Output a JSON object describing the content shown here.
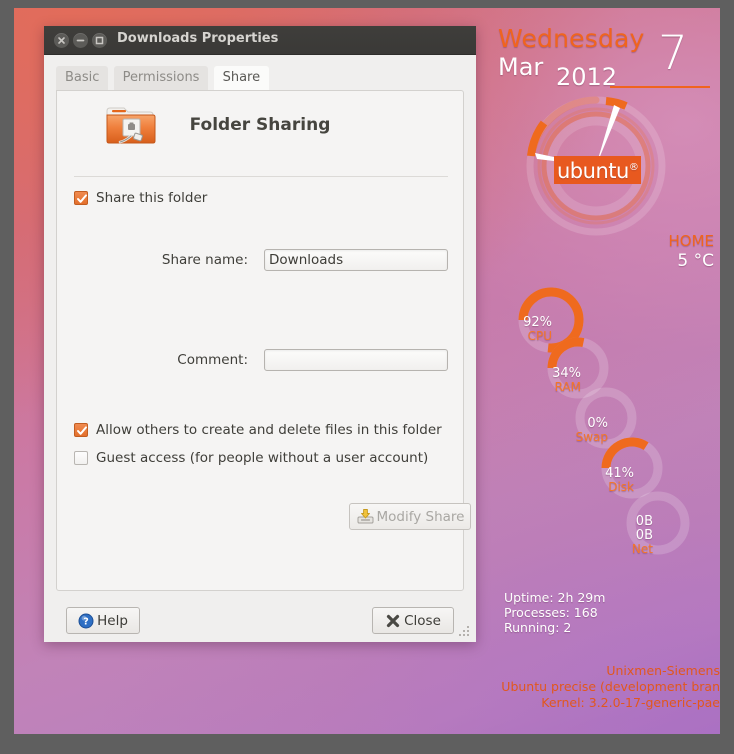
{
  "window": {
    "title": "Downloads Properties",
    "controls": [
      {
        "name": "close",
        "icon": "close-icon"
      },
      {
        "name": "minimize",
        "icon": "minimize-icon"
      },
      {
        "name": "maximize",
        "icon": "maximize-icon"
      }
    ]
  },
  "tabs": [
    {
      "label": "Basic",
      "active": false
    },
    {
      "label": "Permissions",
      "active": false
    },
    {
      "label": "Share",
      "active": true
    }
  ],
  "share_panel": {
    "icon": "shared-folder-icon",
    "heading": "Folder Sharing",
    "share_this_folder": {
      "label": "Share this folder",
      "checked": true
    },
    "share_name": {
      "label": "Share name:",
      "value": "Downloads",
      "placeholder": ""
    },
    "comment": {
      "label": "Comment:",
      "value": "",
      "placeholder": ""
    },
    "allow_create_delete": {
      "label": "Allow others to create and delete files in this folder",
      "checked": true
    },
    "guest_access": {
      "label": "Guest access (for people without a user account)",
      "checked": false
    },
    "modify_share": {
      "label": "Modify Share",
      "icon": "save-to-disk-icon",
      "enabled": false
    }
  },
  "actions": {
    "help": {
      "label": "Help",
      "icon": "help-icon"
    },
    "close": {
      "label": "Close",
      "icon": "close-x-icon"
    }
  },
  "desktop": {
    "conky_date": {
      "weekday": "Wednesday",
      "month": "Mar",
      "year": "2012",
      "day": "7"
    },
    "clock": {
      "logo_text": "ubuntu",
      "logo_mark": "®",
      "hour_angle_deg": 258,
      "minute_angle_deg": 20
    },
    "weather": {
      "location": "HOME",
      "temperature": "5 °C"
    },
    "monitors": [
      {
        "label": "CPU",
        "value": "92%",
        "percent": 92
      },
      {
        "label": "RAM",
        "value": "34%",
        "percent": 34
      },
      {
        "label": "Swap",
        "value": "0%",
        "percent": 0
      },
      {
        "label": "Disk",
        "value": "41%",
        "percent": 41
      },
      {
        "label": "Net",
        "value": "0B",
        "value2": "0B",
        "percent": 0
      }
    ],
    "system": [
      "Uptime: 2h 29m",
      "Processes: 168",
      "Running: 2"
    ],
    "host": [
      "Unixmen-Siemens",
      "Ubuntu precise (development bran",
      "Kernel: 3.2.0-17-generic-pae"
    ]
  },
  "colors": {
    "ubuntu_orange": "#f0641e",
    "accent_checkbox": "#e4702c",
    "titlebar": "#3f3e3b",
    "panel_bg": "#f5f4f3"
  }
}
